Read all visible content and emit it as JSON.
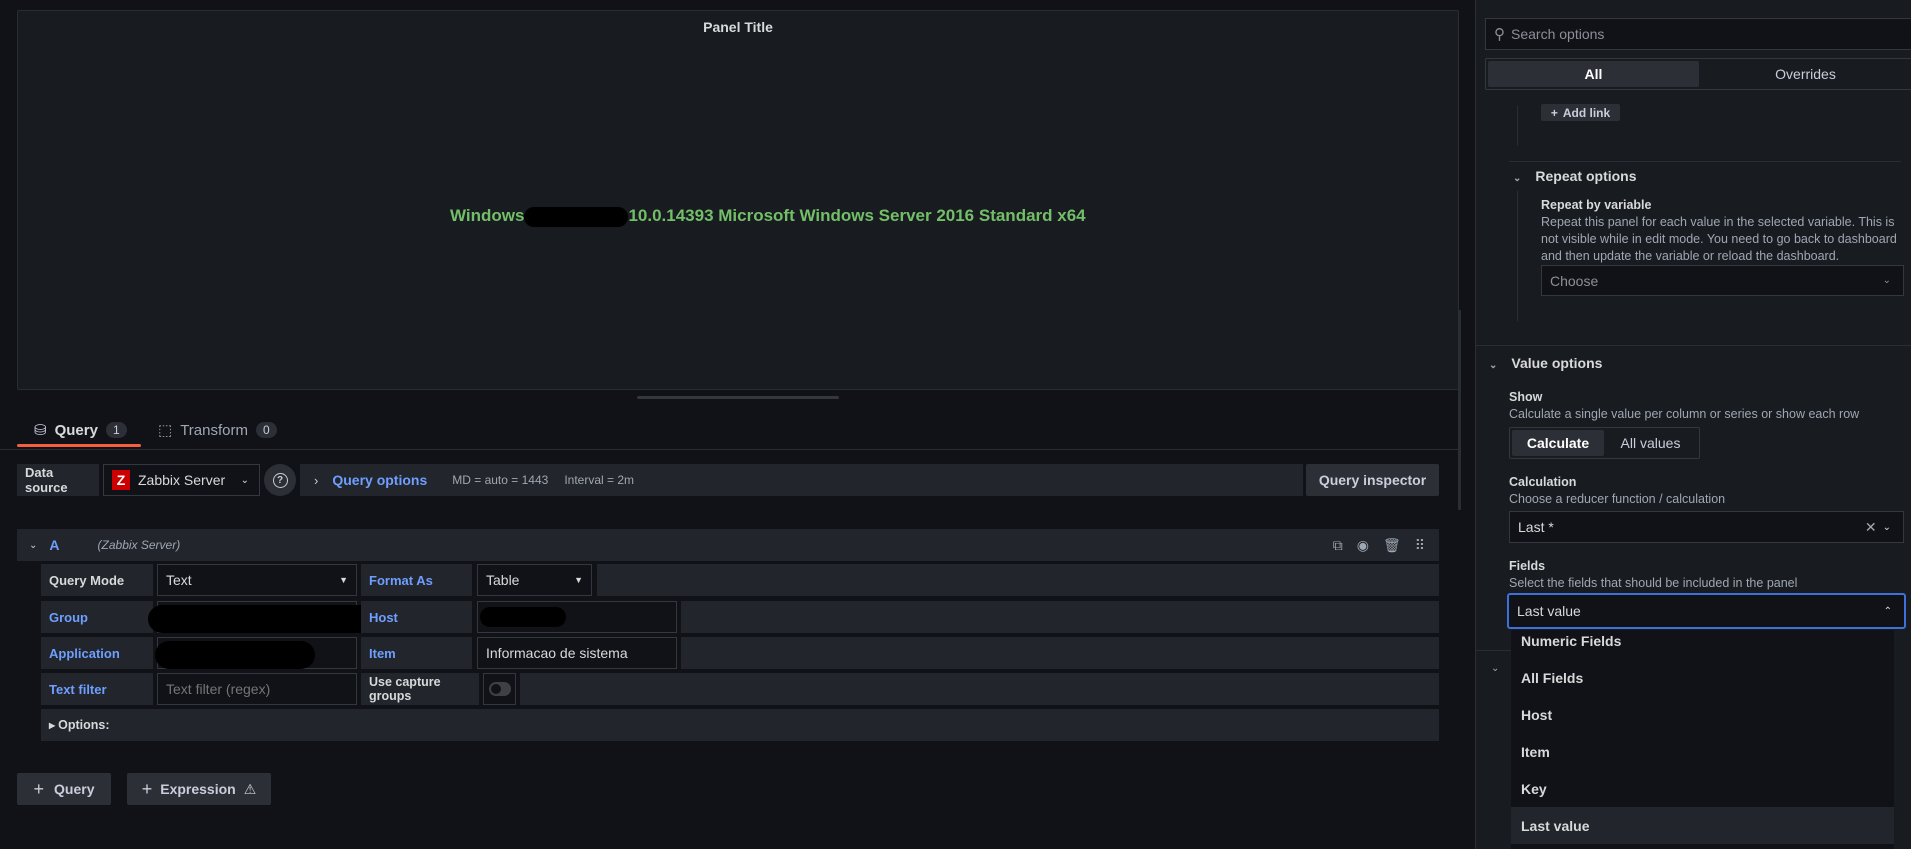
{
  "panel": {
    "title": "Panel Title",
    "value_prefix": "Windows",
    "value_suffix": "10.0.14393 Microsoft Windows Server 2016 Standard x64",
    "value_color": "#73bf69"
  },
  "tabs": [
    {
      "label": "Query",
      "count": "1",
      "icon": "database-icon"
    },
    {
      "label": "Transform",
      "count": "0",
      "icon": "transform-icon"
    }
  ],
  "datasource": {
    "label": "Data source",
    "value": "Zabbix Server",
    "logo": "Z",
    "help": "?",
    "query_options": "Query options",
    "md": "MD = auto = 1443",
    "interval": "Interval = 2m",
    "inspector": "Query inspector"
  },
  "query": {
    "ref": "A",
    "datasource": "(Zabbix Server)",
    "query_mode_label": "Query Mode",
    "query_mode": "Text",
    "format_as_label": "Format As",
    "format_as": "Table",
    "group_label": "Group",
    "host_label": "Host",
    "application_label": "Application",
    "item_label": "Item",
    "item": "Informacao de sistema",
    "text_filter_label": "Text filter",
    "text_filter_placeholder": "Text filter (regex)",
    "capture_label": "Use capture groups",
    "options_label": "Options:"
  },
  "buttons": {
    "add_query": "Query",
    "add_expression": "Expression"
  },
  "options_pane": {
    "search_placeholder": "Search options",
    "tabs": [
      "All",
      "Overrides"
    ],
    "add_link": "Add link",
    "repeat": {
      "title": "Repeat options",
      "label": "Repeat by variable",
      "desc": "Repeat this panel for each value in the selected variable. This is not visible while in edit mode. You need to go back to dashboard and then update the variable or reload the dashboard.",
      "placeholder": "Choose"
    },
    "value": {
      "title": "Value options",
      "show_label": "Show",
      "show_desc": "Calculate a single value per column or series or show each row",
      "show_options": [
        "Calculate",
        "All values"
      ],
      "calc_label": "Calculation",
      "calc_desc": "Choose a reducer function / calculation",
      "calc_value": "Last *",
      "fields_label": "Fields",
      "fields_desc": "Select the fields that should be included in the panel",
      "fields_value": "Last value",
      "fields_options": [
        "Numeric Fields",
        "All Fields",
        "Host",
        "Item",
        "Key",
        "Last value"
      ]
    }
  }
}
